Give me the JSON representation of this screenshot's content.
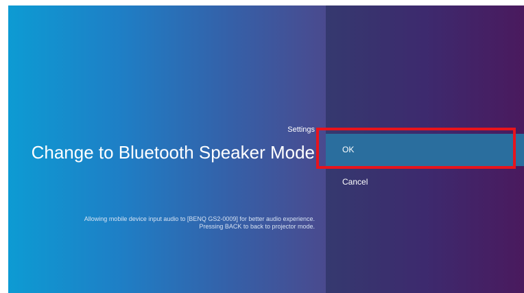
{
  "dialog": {
    "breadcrumb": "Settings",
    "title": "Change to Bluetooth Speaker Mode",
    "description_line1": "Allowing mobile device input audio to [BENQ GS2-0009] for better audio experience.",
    "description_line2": "Pressing BACK to back to projector mode."
  },
  "menu": {
    "items": [
      {
        "label": "OK",
        "selected": true
      },
      {
        "label": "Cancel",
        "selected": false
      }
    ]
  },
  "colors": {
    "left_gradient_start": "#0d9bd3",
    "left_gradient_end": "#4a4a8e",
    "right_gradient_start": "#35396f",
    "right_gradient_end": "#4a1a5e",
    "selected_item_bg": "#2a6e9e",
    "highlight_border": "#e8141c"
  }
}
